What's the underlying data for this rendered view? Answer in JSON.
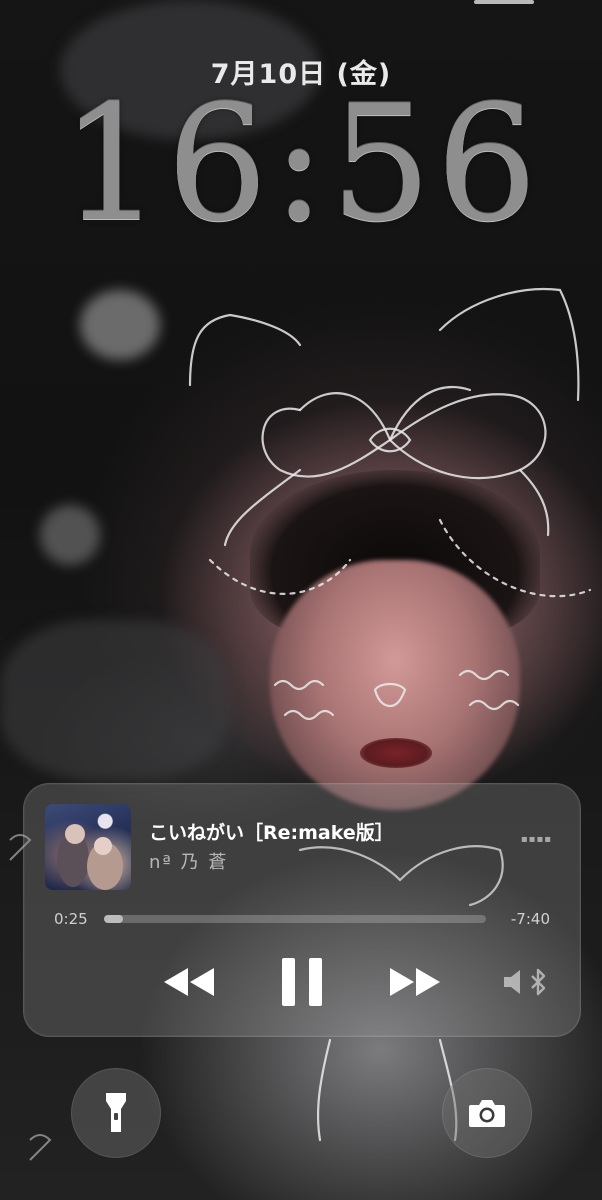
{
  "lock_screen": {
    "date": "7月10日 (金)",
    "time": "16:56"
  },
  "now_playing": {
    "album_art_icon": "album-art",
    "title": "こいねがい［Re:make版］",
    "artist": "nª 乃 蒼",
    "elapsed": "0:25",
    "remaining": "-7:40",
    "progress": 0.05,
    "state": "playing",
    "controls": {
      "rewind_icon": "backward-icon",
      "pause_icon": "pause-icon",
      "forward_icon": "forward-icon",
      "output_icon": "speaker-bluetooth-icon"
    }
  },
  "quick_actions": {
    "left_icon": "flashlight-icon",
    "right_icon": "camera-icon"
  },
  "colors": {
    "time": "#8e8e8e",
    "widget_bg": "rgba(150,150,150,0.30)",
    "text_secondary": "rgba(255,255,255,0.62)"
  }
}
